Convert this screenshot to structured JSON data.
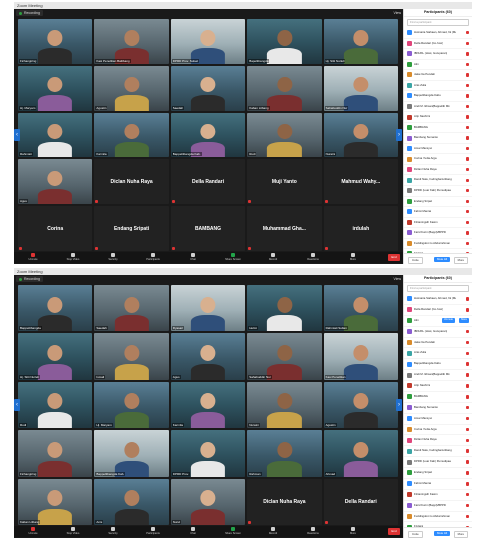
{
  "shot1": {
    "title_bar": "Zoom Meeting",
    "recording_label": "Recording",
    "view_label": "View",
    "tiles": [
      {
        "type": "cam",
        "caption": "Fichangiring"
      },
      {
        "type": "cam",
        "caption": "Kasi Penelitian Balitbang"
      },
      {
        "type": "cam",
        "caption": "DPRD Prov. Sulsel"
      },
      {
        "type": "cam",
        "caption": "Bapelitbangda"
      },
      {
        "type": "cam",
        "caption": "Hj. Sitti Nurleli"
      },
      {
        "type": "cam",
        "caption": "Hj. Maryam"
      },
      {
        "type": "cam",
        "caption": "Agustin"
      },
      {
        "type": "cam",
        "caption": "Saedah"
      },
      {
        "type": "cam",
        "caption": "Kaban Litbang"
      },
      {
        "type": "cam",
        "caption": "Sahabuddin Nur"
      },
      {
        "type": "cam",
        "caption": "Rahmiati"
      },
      {
        "type": "cam",
        "caption": "Karmila"
      },
      {
        "type": "cam",
        "caption": "Bappelitbangda Kab."
      },
      {
        "type": "cam",
        "caption": "Rudi"
      },
      {
        "type": "cam",
        "caption": "Nuraini"
      },
      {
        "type": "cam",
        "caption": "Agus"
      },
      {
        "type": "name",
        "label": "Diclan Nuha Raya"
      },
      {
        "type": "name",
        "label": "Della Randari"
      },
      {
        "type": "name",
        "label": "Muji Yanto"
      },
      {
        "type": "name",
        "label": "Mahmud Wahy..."
      },
      {
        "type": "name",
        "label": "Corina"
      },
      {
        "type": "name",
        "label": "Endang Sripati"
      },
      {
        "type": "name",
        "label": "BAMBANG"
      },
      {
        "type": "name",
        "label": "Muhammad Gha..."
      },
      {
        "type": "name",
        "label": "irdulah"
      }
    ],
    "toolbar": [
      "Unmute",
      "Stop Video",
      "Security",
      "Participants",
      "Chat",
      "Share Screen",
      "Record",
      "Reactions",
      "More"
    ],
    "end_label": "End",
    "participants_title": "Participants (60)",
    "participants_search": "Find a participant",
    "participants": [
      {
        "name": "Hotmaria Siahaan, Ahmad, hk (Me)",
        "color": "#2d8cff"
      },
      {
        "name": "Della Randari (Co-host)",
        "color": "#e0457b"
      },
      {
        "name": "IBNUKL (Host, Guruparan)",
        "color": "#8a5cd1"
      },
      {
        "name": "Alm",
        "color": "#2e9e3e"
      },
      {
        "name": "Jaka rita Pendali",
        "color": "#d98b2b"
      },
      {
        "name": "Anis Zulia",
        "color": "#3aa5a5"
      },
      {
        "name": "Bappelitbangda Kabu",
        "color": "#2d8cff"
      },
      {
        "name": "Andi M. Ikhsan(Bappelitb Mk",
        "color": "#7a7a7a"
      },
      {
        "name": "Arip Nashirni",
        "color": "#c0392b"
      },
      {
        "name": "BAMBANG",
        "color": "#2e9e3e"
      },
      {
        "name": "Bambang Sumanto",
        "color": "#8a5cd1"
      },
      {
        "name": "Amar Mansyur",
        "color": "#2d8cff"
      },
      {
        "name": "Corina Yudia Arga",
        "color": "#d98b2b"
      },
      {
        "name": "Diclan Nuha Raya",
        "color": "#e0457b"
      },
      {
        "name": "Dandi Natu, hodingbanLitbang",
        "color": "#3aa5a5"
      },
      {
        "name": "DPRD (Luar Kab) Pemudipaa",
        "color": "#7a7a7a"
      },
      {
        "name": "Endang Sripati",
        "color": "#2e9e3e"
      },
      {
        "name": "Fahmi Manrai",
        "color": "#2d8cff"
      },
      {
        "name": "Fitrianingsih Kasim",
        "color": "#c0392b"
      },
      {
        "name": "Farid Kurni (Bappl)/BPPD",
        "color": "#8a5cd1"
      },
      {
        "name": "Fuddingdoni to Abdurrahman",
        "color": "#d98b2b"
      },
      {
        "name": "Fridaini",
        "color": "#2e9e3e"
      },
      {
        "name": "Gaba Hifdaniah Bagian Kebijakan",
        "color": "#3aa5a5"
      },
      {
        "name": "Muhammad Ghadafi",
        "color": "#e0457b"
      }
    ],
    "footer": {
      "invite": "Invite",
      "mute_all": "Mute All",
      "more": "More"
    }
  },
  "shot2": {
    "title_bar": "Zoom Meeting",
    "recording_label": "Recording",
    "view_label": "View",
    "tiles": [
      {
        "type": "cam",
        "caption": "Bappelitbangda"
      },
      {
        "type": "cam",
        "caption": "Saedah"
      },
      {
        "type": "cam",
        "caption": "Ryasari"
      },
      {
        "type": "cam",
        "caption": "Helmi"
      },
      {
        "type": "cam",
        "caption": "Rahmiati Sultan"
      },
      {
        "type": "cam",
        "caption": "Hj. Sitti Nurleli"
      },
      {
        "type": "cam",
        "caption": "Ismail"
      },
      {
        "type": "cam",
        "caption": "Agus"
      },
      {
        "type": "cam",
        "caption": "Sahabuddin Nur"
      },
      {
        "type": "cam",
        "caption": "Kasi Penelitian"
      },
      {
        "type": "cam",
        "caption": "Rudi"
      },
      {
        "type": "cam",
        "caption": "Hj. Maryam"
      },
      {
        "type": "cam",
        "caption": "Karmila"
      },
      {
        "type": "cam",
        "caption": "Nuraini"
      },
      {
        "type": "cam",
        "caption": "Agustin"
      },
      {
        "type": "cam",
        "caption": "Fichangiring"
      },
      {
        "type": "cam",
        "caption": "Bappelitbangda Kab."
      },
      {
        "type": "cam",
        "caption": "DPRD Prov."
      },
      {
        "type": "cam",
        "caption": "Rahman"
      },
      {
        "type": "cam",
        "caption": "Ahmad"
      },
      {
        "type": "cam",
        "caption": "Kaban Litbang"
      },
      {
        "type": "cam",
        "caption": "Anis"
      },
      {
        "type": "cam",
        "caption": "Nurul"
      },
      {
        "type": "name",
        "label": "Diclan Nuha Raya"
      },
      {
        "type": "name",
        "label": "Della Randari"
      }
    ],
    "toolbar": [
      "Unmute",
      "Stop Video",
      "Security",
      "Participants",
      "Chat",
      "Share Screen",
      "Record",
      "Reactions",
      "More"
    ],
    "end_label": "End",
    "participants_title": "Participants (60)",
    "participants_search": "Find a participant",
    "participants": [
      {
        "name": "Hotmaria Siahaan, Ahmad, hk (Me)",
        "color": "#2d8cff"
      },
      {
        "name": "Della Randari (Co-host)",
        "color": "#e0457b"
      },
      {
        "name": "Alm",
        "color": "#2e9e3e",
        "buttons": [
          "Unmute",
          "More"
        ]
      },
      {
        "name": "IBNUKL (Host, Guruparan)",
        "color": "#8a5cd1"
      },
      {
        "name": "Jaka rita Pendali",
        "color": "#d98b2b"
      },
      {
        "name": "Anis Zulia",
        "color": "#3aa5a5"
      },
      {
        "name": "Bappelitbangda Kabu",
        "color": "#2d8cff"
      },
      {
        "name": "Andi M. Ikhsan(Bappelitb Mk",
        "color": "#7a7a7a"
      },
      {
        "name": "Arip Nashirni",
        "color": "#c0392b"
      },
      {
        "name": "BAMBANG",
        "color": "#2e9e3e"
      },
      {
        "name": "Bambang Sumanto",
        "color": "#8a5cd1"
      },
      {
        "name": "Amar Mansyur",
        "color": "#2d8cff"
      },
      {
        "name": "Corina Yudia Arga",
        "color": "#d98b2b"
      },
      {
        "name": "Diclan Nuha Raya",
        "color": "#e0457b"
      },
      {
        "name": "Dandi Natu, hodingbanLitbang",
        "color": "#3aa5a5"
      },
      {
        "name": "DPRD (Luar Kab) Pemudipaa",
        "color": "#7a7a7a"
      },
      {
        "name": "Endang Sripati",
        "color": "#2e9e3e"
      },
      {
        "name": "Fahmi Manrai",
        "color": "#2d8cff"
      },
      {
        "name": "Fitrianingsih Kasim",
        "color": "#c0392b"
      },
      {
        "name": "Farid Kurni (Bappl)/BPPD",
        "color": "#8a5cd1"
      },
      {
        "name": "Fuddingdoni to Abdurrahman",
        "color": "#d98b2b"
      },
      {
        "name": "Fridaini",
        "color": "#2e9e3e"
      },
      {
        "name": "Gaba Hifdaniah Bagian Kebijakan",
        "color": "#3aa5a5"
      },
      {
        "name": "Muhammad Ghadafi",
        "color": "#e0457b"
      }
    ],
    "footer": {
      "invite": "Invite",
      "mute_all": "Mute All",
      "more": "More"
    }
  }
}
